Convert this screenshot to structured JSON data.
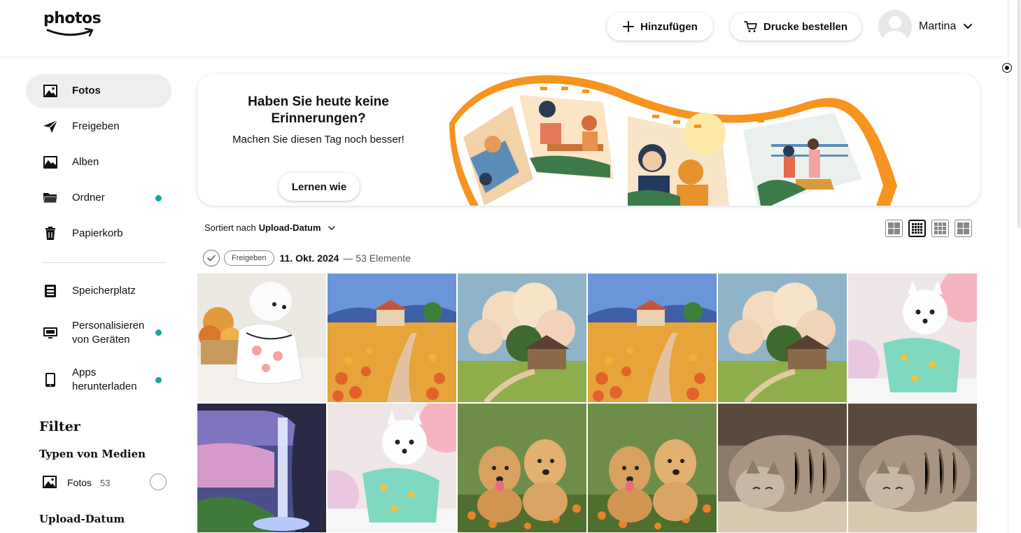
{
  "header": {
    "logo_text": "photos",
    "add_label": "Hinzufügen",
    "print_label": "Drucke bestellen",
    "user_name": "Martina"
  },
  "sidebar": {
    "items": [
      {
        "label": "Fotos",
        "icon": "photo-icon",
        "active": true
      },
      {
        "label": "Freigeben",
        "icon": "send-icon"
      },
      {
        "label": "Alben",
        "icon": "album-icon"
      },
      {
        "label": "Ordner",
        "icon": "folder-icon",
        "dot": true
      },
      {
        "label": "Papierkorb",
        "icon": "trash-icon"
      },
      {
        "label": "Speicherplatz",
        "icon": "storage-icon"
      },
      {
        "label_line1": "Personalisieren",
        "label_line2": "von Geräten",
        "icon": "monitor-icon",
        "dot": true
      },
      {
        "label_line1": "Apps",
        "label_line2": "herunterladen",
        "icon": "phone-icon",
        "dot": true
      }
    ],
    "filter_title": "Filter",
    "media_types_title": "Typen von Medien",
    "media_filter": {
      "label": "Fotos",
      "count": "53"
    },
    "upload_date_title": "Upload-Datum"
  },
  "banner": {
    "title": "Haben Sie heute keine Erinnerungen?",
    "text": "Machen Sie diesen Tag noch besser!",
    "button": "Lernen wie"
  },
  "toolbar": {
    "sort_prefix": "Sortiert nach",
    "sort_value": "Upload-Datum"
  },
  "group": {
    "share_label": "Freigeben",
    "date": "11. Okt. 2024",
    "count": "— 53 Elemente"
  },
  "colors": {
    "accent_dot": "#1aa69a",
    "banner_orange": "#f7931e"
  },
  "photos": [
    {
      "subject": "white dog in dress with flowers"
    },
    {
      "subject": "painted field with poppies and house"
    },
    {
      "subject": "painted cottage under clouds"
    },
    {
      "subject": "painted field with poppies and house"
    },
    {
      "subject": "painted cottage under clouds"
    },
    {
      "subject": "white pomeranian in dino pajamas"
    },
    {
      "subject": "waterfall cave at sunset"
    },
    {
      "subject": "white pomeranian in dino pajamas"
    },
    {
      "subject": "two golden puppies in flowers"
    },
    {
      "subject": "two golden puppies in flowers"
    },
    {
      "subject": "sleeping tabby cat"
    },
    {
      "subject": "sleeping tabby cat"
    }
  ]
}
